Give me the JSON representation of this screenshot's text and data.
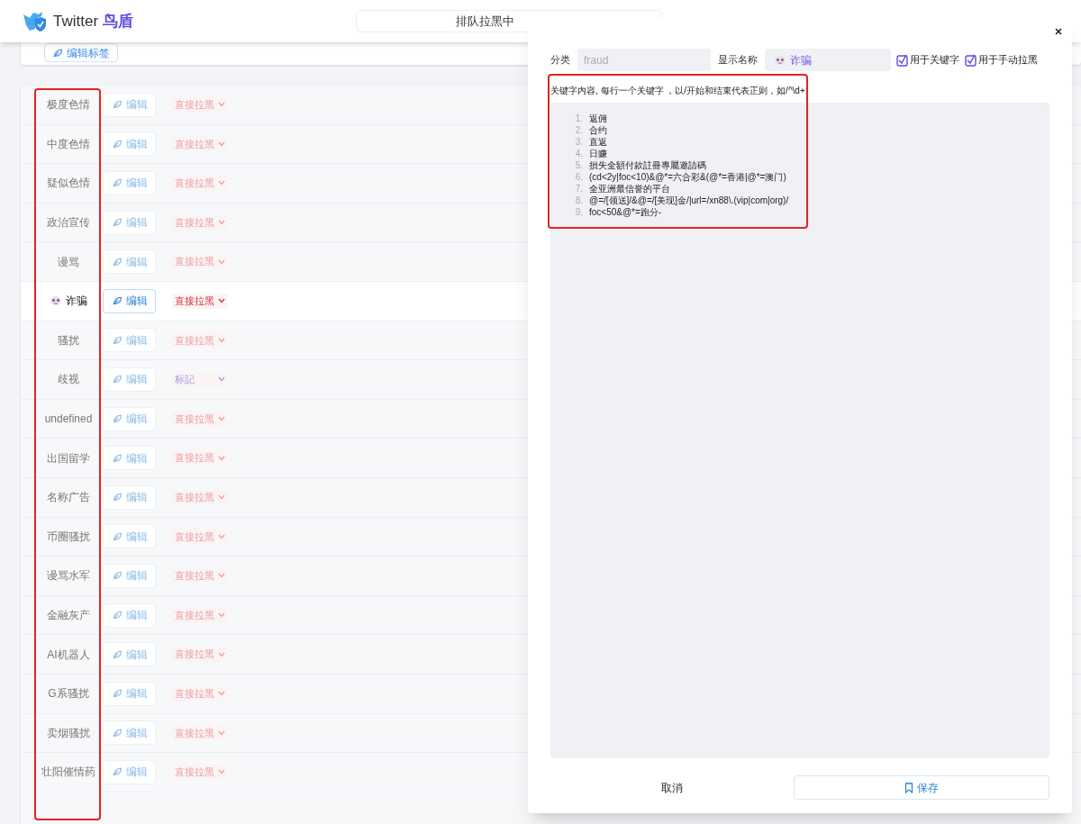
{
  "header": {
    "brand": "Twitter",
    "brand_accent": "鸟盾",
    "queue_text": "排队拉黑中"
  },
  "top_card": {
    "button": "编辑标签"
  },
  "categories": [
    {
      "label": "极度色情",
      "icon": false,
      "selected": false,
      "edit": "编辑",
      "action": {
        "kind": "block",
        "label": "直接拉黑"
      }
    },
    {
      "label": "中度色情",
      "icon": false,
      "selected": false,
      "edit": "编辑",
      "action": {
        "kind": "block",
        "label": "直接拉黑"
      }
    },
    {
      "label": "疑似色情",
      "icon": false,
      "selected": false,
      "edit": "编辑",
      "action": {
        "kind": "block",
        "label": "直接拉黑"
      }
    },
    {
      "label": "政治宣传",
      "icon": false,
      "selected": false,
      "edit": "编辑",
      "action": {
        "kind": "block",
        "label": "直接拉黑"
      }
    },
    {
      "label": "谩骂",
      "icon": false,
      "selected": false,
      "edit": "编辑",
      "action": {
        "kind": "block",
        "label": "直接拉黑"
      }
    },
    {
      "label": "诈骗",
      "icon": true,
      "selected": true,
      "edit": "编辑",
      "action": {
        "kind": "block",
        "label": "直接拉黑"
      }
    },
    {
      "label": "骚扰",
      "icon": false,
      "selected": false,
      "edit": "编辑",
      "action": {
        "kind": "block",
        "label": "直接拉黑"
      }
    },
    {
      "label": "歧视",
      "icon": false,
      "selected": false,
      "edit": "编辑",
      "action": {
        "kind": "mark",
        "label": "标記"
      }
    },
    {
      "label": "undefined",
      "icon": false,
      "selected": false,
      "edit": "编辑",
      "action": {
        "kind": "block",
        "label": "直接拉黑"
      }
    },
    {
      "label": "出国留学",
      "icon": false,
      "selected": false,
      "edit": "编辑",
      "action": {
        "kind": "block",
        "label": "直接拉黑"
      }
    },
    {
      "label": "名称广告",
      "icon": false,
      "selected": false,
      "edit": "编辑",
      "action": {
        "kind": "block",
        "label": "直接拉黑"
      }
    },
    {
      "label": "币圈骚扰",
      "icon": false,
      "selected": false,
      "edit": "编辑",
      "action": {
        "kind": "block",
        "label": "直接拉黑"
      }
    },
    {
      "label": "谩骂水军",
      "icon": false,
      "selected": false,
      "edit": "编辑",
      "action": {
        "kind": "block",
        "label": "直接拉黑"
      }
    },
    {
      "label": "金融灰产",
      "icon": false,
      "selected": false,
      "edit": "编辑",
      "action": {
        "kind": "block",
        "label": "直接拉黑"
      }
    },
    {
      "label": "AI机器人",
      "icon": false,
      "selected": false,
      "edit": "编辑",
      "action": {
        "kind": "block",
        "label": "直接拉黑"
      }
    },
    {
      "label": "G系骚扰",
      "icon": false,
      "selected": false,
      "edit": "编辑",
      "action": {
        "kind": "block",
        "label": "直接拉黑"
      }
    },
    {
      "label": "卖烟骚扰",
      "icon": false,
      "selected": false,
      "edit": "编辑",
      "action": {
        "kind": "block",
        "label": "直接拉黑"
      }
    },
    {
      "label": "壮阳催情药",
      "icon": false,
      "selected": false,
      "edit": "编辑",
      "action": {
        "kind": "block",
        "label": "直接拉黑"
      }
    }
  ],
  "dialog": {
    "category_label": "分类",
    "category_placeholder": "fraud",
    "display_label": "显示名称",
    "display_icon": true,
    "display_value": "诈骗",
    "checks": [
      {
        "label": "用于关键字",
        "checked": true
      },
      {
        "label": "用于手动拉黑",
        "checked": true
      }
    ],
    "note": "关键字内容, 每行一个关键字 ，以/开始和结束代表正则，如/^\\d+:",
    "keywords": [
      {
        "number": "1.",
        "text": "返佣"
      },
      {
        "number": "2.",
        "text": "合约"
      },
      {
        "number": "3.",
        "text": "直返"
      },
      {
        "number": "4.",
        "text": "日赚"
      },
      {
        "number": "5.",
        "text": "損失全額付款註冊專屬邀請碼"
      },
      {
        "number": "6.",
        "text": "(cd<2y|foc<10)&@*=六合彩&(@*=香港|@*=澳门)"
      },
      {
        "number": "7.",
        "text": "全亚洲最信誉的平台"
      },
      {
        "number": "8.",
        "text": "@=/[领送]/&@=/[美现]金/|url=/xn88\\.(vip|com|org)/"
      },
      {
        "number": "9.",
        "text": "foc<50&@*=跑分-"
      }
    ],
    "cancel": "取消",
    "save": "保存"
  }
}
